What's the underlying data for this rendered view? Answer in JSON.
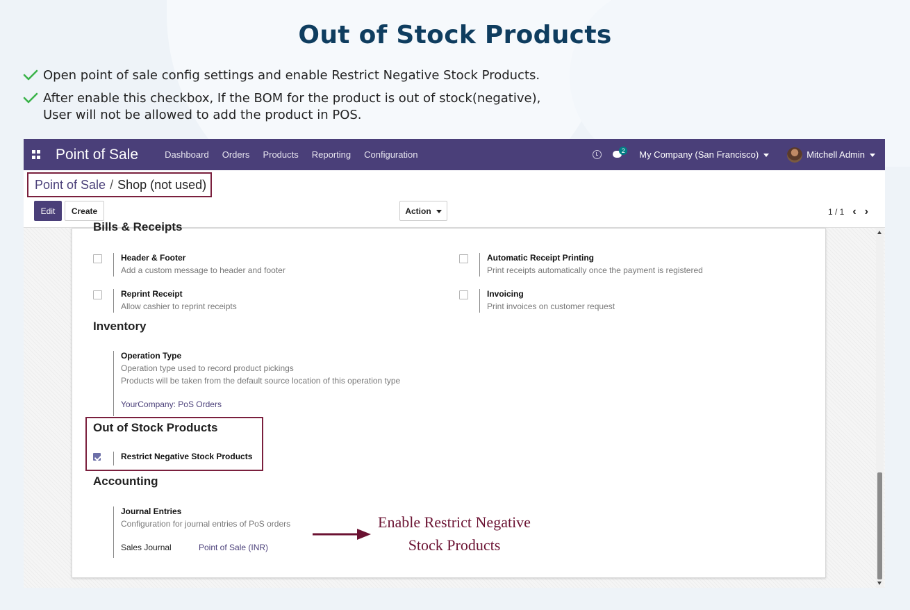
{
  "doc": {
    "title": "Out of Stock Products",
    "bullets": [
      "Open point of sale config settings and enable Restrict Negative Stock Products.",
      "After enable this checkbox, If the BOM for the product is out of stock(negative),\nUser will not be allowed to add the product in POS."
    ],
    "bullet_icon": "check-icon",
    "annotation_line1": "Enable Restrict Negative",
    "annotation_line2": "Stock Products"
  },
  "navbar": {
    "app_name": "Point of Sale",
    "menu": [
      "Dashboard",
      "Orders",
      "Products",
      "Reporting",
      "Configuration"
    ],
    "chat_count": "2",
    "company": "My Company (San Francisco)",
    "user": "Mitchell Admin"
  },
  "control_panel": {
    "breadcrumb_parent": "Point of Sale",
    "breadcrumb_sep": "/",
    "breadcrumb_current": "Shop (not used)",
    "edit_label": "Edit",
    "create_label": "Create",
    "action_label": "Action",
    "pager": "1 / 1"
  },
  "settings": {
    "bills_heading": "Bills & Receipts",
    "header_footer": {
      "label": "Header & Footer",
      "desc": "Add a custom message to header and footer",
      "checked": false
    },
    "auto_print": {
      "label": "Automatic Receipt Printing",
      "desc": "Print receipts automatically once the payment is registered",
      "checked": false
    },
    "reprint": {
      "label": "Reprint Receipt",
      "desc": "Allow cashier to reprint receipts",
      "checked": false
    },
    "invoicing": {
      "label": "Invoicing",
      "desc": "Print invoices on customer request",
      "checked": false
    },
    "inventory_heading": "Inventory",
    "operation_type": {
      "label": "Operation Type",
      "desc1": "Operation type used to record product pickings",
      "desc2": "Products will be taken from the default source location of this operation type",
      "value": "YourCompany: PoS Orders"
    },
    "oos_heading": "Out of Stock Products",
    "restrict_negative": {
      "label": "Restrict Negative Stock Products",
      "checked": true
    },
    "accounting_heading": "Accounting",
    "journal_entries": {
      "label": "Journal Entries",
      "desc": "Configuration for journal entries of PoS orders",
      "field_label": "Sales Journal",
      "field_value": "Point of Sale (INR)"
    }
  },
  "colors": {
    "navbar": "#4a3f79",
    "title": "#0f3d5f",
    "highlight": "#7a1f3d",
    "check": "#3bb34a"
  }
}
